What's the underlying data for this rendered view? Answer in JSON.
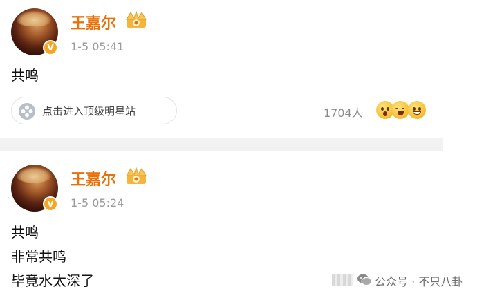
{
  "posts": [
    {
      "author": "王嘉尔",
      "badge": "V",
      "time": "1-5 05:41",
      "lines": [
        "共鸣"
      ]
    },
    {
      "author": "王嘉尔",
      "badge": "V",
      "time": "1-5 05:24",
      "lines": [
        "共鸣",
        "非常共鸣",
        "毕竟水太深了"
      ]
    }
  ],
  "star_chip": {
    "label": "点击进入顶级明星站",
    "icon": "flower-icon"
  },
  "reactions": {
    "count": "1704人",
    "emojis": [
      "surprised-emoji-icon",
      "laughing-emoji-icon",
      "grin-emoji-icon"
    ]
  },
  "watermark": {
    "text": "公众号 · 不只八卦",
    "icon": "wechat-icon"
  },
  "colors": {
    "name": "#e8710a",
    "badge": "#f5a623",
    "time": "#9b9b9b"
  }
}
